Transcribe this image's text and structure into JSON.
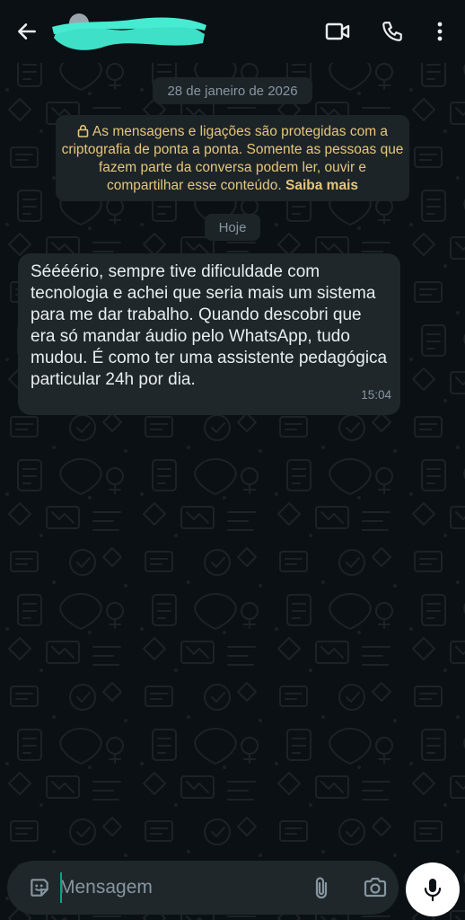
{
  "header": {
    "back_icon": "arrow-left-icon",
    "contact_name": "",
    "actions": [
      "video-call-icon",
      "voice-call-icon",
      "more-vertical-icon"
    ]
  },
  "chat": {
    "date_chip": "28 de janeiro de 2026",
    "encryption_notice": {
      "icon": "lock-icon",
      "text": "As mensagens e ligações são protegidas com a criptografia de ponta a ponta. Somente as pessoas que fazem parte da conversa podem ler, ouvir e compartilhar esse conteúdo.",
      "learn_more": "Saiba mais"
    },
    "today_chip": "Hoje",
    "messages": [
      {
        "direction": "incoming",
        "text": "Séééério, sempre tive dificuldade com tecnologia e achei que seria mais um sistema para me dar trabalho. Quando descobri que era só mandar áudio pelo WhatsApp, tudo mudou. É como ter uma assistente pedagógica particular 24h por dia.",
        "time": "15:04"
      }
    ]
  },
  "composer": {
    "placeholder": "Mensagem",
    "value": "",
    "emoji_icon": "sticker-icon",
    "attach_icon": "paperclip-icon",
    "camera_icon": "camera-icon",
    "mic_icon": "microphone-icon"
  },
  "colors": {
    "background": "#0b1014",
    "bubble_incoming": "#1f272a",
    "system_chip": "#1d2428",
    "encryption_text": "#e5c67a",
    "muted_text": "#8696a0",
    "primary_text": "#e9edef",
    "redaction": "#3fe0c8",
    "accent": "#00a884"
  }
}
